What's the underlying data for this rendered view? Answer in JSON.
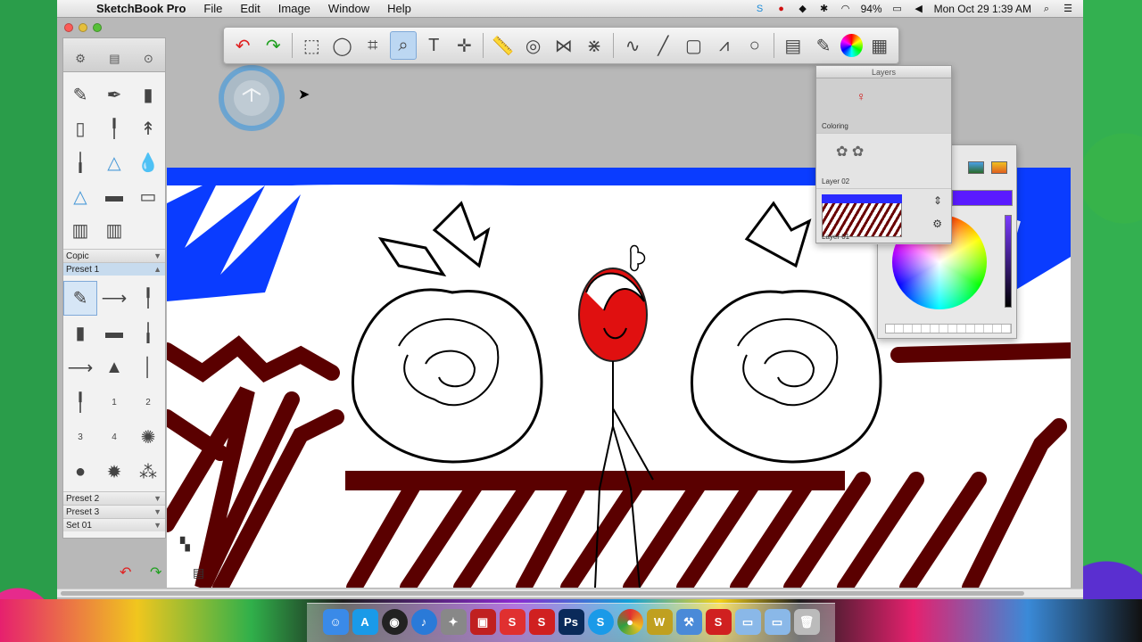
{
  "menubar": {
    "app_name": "SketchBook Pro",
    "menus": [
      "File",
      "Edit",
      "Image",
      "Window",
      "Help"
    ],
    "battery": "94%",
    "clock": "Mon Oct 29  1:39 AM"
  },
  "toolbar": {
    "tools": [
      "undo-icon",
      "redo-icon",
      "rect-select-icon",
      "lasso-icon",
      "crop-icon",
      "zoom-icon",
      "text-icon",
      "move-icon",
      "ruler-icon",
      "ellipse-guide-icon",
      "symmetry-icon",
      "perspective-icon",
      "curve-icon",
      "line-icon",
      "rectangle-icon",
      "polyline-icon",
      "ellipse-icon",
      "layer-editor-icon",
      "brush-palette-icon",
      "color-wheel-icon",
      "grid-icon"
    ],
    "active_tool": "zoom-icon"
  },
  "brush_panel": {
    "header_icons": [
      "settings-icon",
      "palette-icon",
      "target-icon"
    ],
    "library_label": "Copic",
    "preset_1_label": "Preset 1",
    "preset_2_label": "Preset 2",
    "preset_3_label": "Preset 3",
    "set_01_label": "Set 01",
    "preset_numbers": [
      "1",
      "2",
      "3",
      "4"
    ]
  },
  "layers_panel": {
    "title": "Layers",
    "layers": [
      {
        "name": "Coloring"
      },
      {
        "name": "Layer 02"
      },
      {
        "name": "Layer 01"
      }
    ]
  },
  "color_panel": {
    "current_color": "#5a1aff"
  },
  "canvas": {
    "colors": {
      "blue": "#0a3cff",
      "maroon": "#5a0000",
      "red": "#e01010"
    }
  },
  "dock": {
    "apps": [
      "Finder",
      "App Store",
      "Dashboard",
      "iTunes",
      "Launchpad",
      "Photo Booth",
      "SketchBook",
      "SketchBook Express",
      "Photoshop",
      "Skype",
      "Chrome",
      "Word",
      "Xcode",
      "SketchBook Pro",
      "Folder",
      "Documents",
      "Trash"
    ]
  }
}
